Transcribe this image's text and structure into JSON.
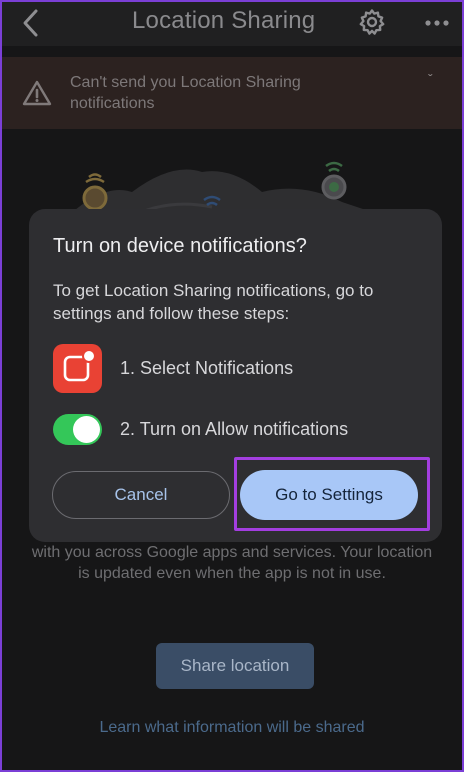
{
  "header": {
    "title": "Location Sharing",
    "back_icon": "chevron-left-icon",
    "settings_icon": "gear-icon",
    "more_icon": "more-horizontal-icon"
  },
  "banner": {
    "text": "Can't send you Location Sharing notifications",
    "icon": "warning-icon",
    "dismiss_glyph": "ˇ"
  },
  "background": {
    "description": "with you across Google apps and services. Your location is updated even when the app is not in use.",
    "share_label": "Share location",
    "learn_label": "Learn what information will be shared"
  },
  "dialog": {
    "title": "Turn on device notifications?",
    "body": "To get Location Sharing notifications, go to settings and follow these steps:",
    "steps": [
      {
        "label": "1. Select Notifications",
        "icon": "notifications-app-icon"
      },
      {
        "label": "2. Turn on Allow notifications",
        "icon": "toggle-switch-icon"
      }
    ],
    "cancel_label": "Cancel",
    "confirm_label": "Go to Settings"
  },
  "colors": {
    "accent": "#a8c7f7",
    "highlight": "#a33ee0",
    "toggle_on": "#34c759",
    "notif_red": "#e94234"
  }
}
